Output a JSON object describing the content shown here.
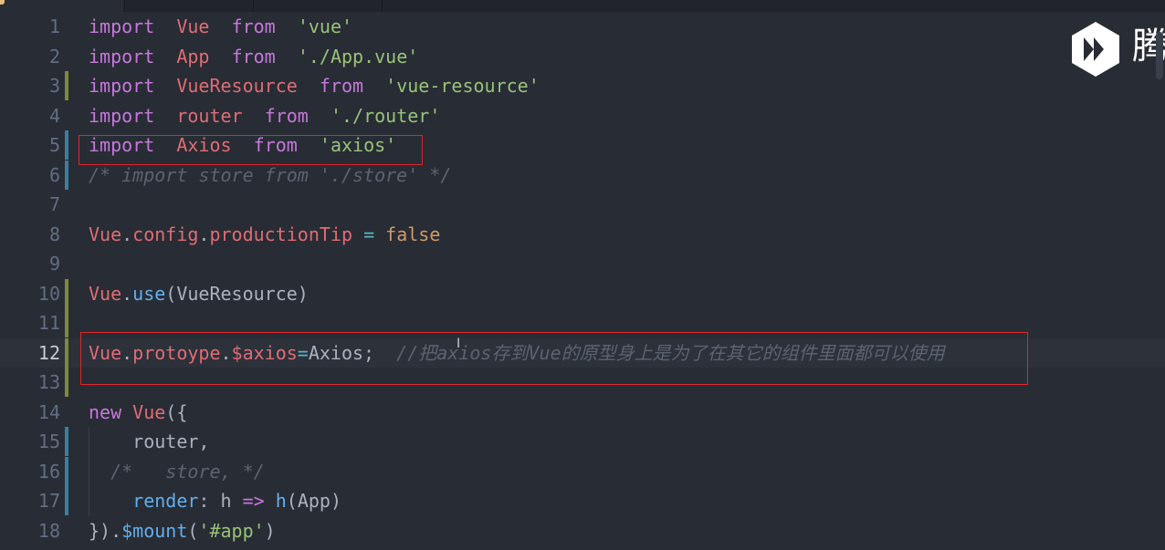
{
  "lines": [
    {
      "n": "1",
      "tokens": [
        [
          "kw",
          "import"
        ],
        [
          "",
          "  "
        ],
        [
          "id",
          "Vue"
        ],
        [
          "",
          "  "
        ],
        [
          "kw",
          "from"
        ],
        [
          "",
          "  "
        ],
        [
          "str",
          "'vue'"
        ]
      ]
    },
    {
      "n": "2",
      "tokens": [
        [
          "kw",
          "import"
        ],
        [
          "",
          "  "
        ],
        [
          "id",
          "App"
        ],
        [
          "",
          "  "
        ],
        [
          "kw",
          "from"
        ],
        [
          "",
          "  "
        ],
        [
          "str",
          "'./App.vue'"
        ]
      ]
    },
    {
      "n": "3",
      "tokens": [
        [
          "kw",
          "import"
        ],
        [
          "",
          "  "
        ],
        [
          "id",
          "VueResource"
        ],
        [
          "",
          "  "
        ],
        [
          "kw",
          "from"
        ],
        [
          "",
          "  "
        ],
        [
          "str",
          "'vue-resource'"
        ]
      ]
    },
    {
      "n": "4",
      "tokens": [
        [
          "kw",
          "import"
        ],
        [
          "",
          "  "
        ],
        [
          "id",
          "router"
        ],
        [
          "",
          "  "
        ],
        [
          "kw",
          "from"
        ],
        [
          "",
          "  "
        ],
        [
          "str",
          "'./router'"
        ]
      ]
    },
    {
      "n": "5",
      "tokens": [
        [
          "kw",
          "import"
        ],
        [
          "",
          "  "
        ],
        [
          "id",
          "Axios"
        ],
        [
          "",
          "  "
        ],
        [
          "kw",
          "from"
        ],
        [
          "",
          "  "
        ],
        [
          "str",
          "'axios'"
        ]
      ]
    },
    {
      "n": "6",
      "tokens": [
        [
          "cm",
          "/* import store from './store' */"
        ]
      ]
    },
    {
      "n": "7",
      "tokens": []
    },
    {
      "n": "8",
      "tokens": [
        [
          "id",
          "Vue"
        ],
        [
          "",
          "."
        ],
        [
          "id",
          "config"
        ],
        [
          "",
          "."
        ],
        [
          "id",
          "productionTip"
        ],
        [
          "",
          " "
        ],
        [
          "op",
          "="
        ],
        [
          "",
          " "
        ],
        [
          "lit",
          "false"
        ]
      ]
    },
    {
      "n": "9",
      "tokens": []
    },
    {
      "n": "10",
      "tokens": [
        [
          "id",
          "Vue"
        ],
        [
          "",
          "."
        ],
        [
          "fn",
          "use"
        ],
        [
          "",
          "(VueResource)"
        ]
      ]
    },
    {
      "n": "11",
      "tokens": []
    },
    {
      "n": "12",
      "tokens": [
        [
          "id",
          "Vue"
        ],
        [
          "",
          "."
        ],
        [
          "id",
          "protoype"
        ],
        [
          "",
          "."
        ],
        [
          "id",
          "$axios"
        ],
        [
          "op",
          "="
        ],
        [
          "",
          "Axios;  "
        ],
        [
          "cm",
          "//把axios存到Vue的原型身上是为了在其它的组件里面都可以使用"
        ]
      ]
    },
    {
      "n": "13",
      "tokens": []
    },
    {
      "n": "14",
      "tokens": [
        [
          "kw",
          "new"
        ],
        [
          "",
          " "
        ],
        [
          "id",
          "Vue"
        ],
        [
          "",
          "({"
        ]
      ]
    },
    {
      "n": "15",
      "tokens": [
        [
          "",
          "    router,"
        ]
      ]
    },
    {
      "n": "16",
      "tokens": [
        [
          "",
          "  "
        ],
        [
          "cm",
          "/*   store, */"
        ]
      ]
    },
    {
      "n": "17",
      "tokens": [
        [
          "",
          "    "
        ],
        [
          "fn",
          "render"
        ],
        [
          "",
          ": h "
        ],
        [
          "kw",
          "=>"
        ],
        [
          "",
          " "
        ],
        [
          "fn",
          "h"
        ],
        [
          "",
          "(App)"
        ]
      ]
    },
    {
      "n": "18",
      "tokens": [
        [
          "",
          "})."
        ],
        [
          "fn",
          "$mount"
        ],
        [
          "",
          "("
        ],
        [
          "str",
          "'#app'"
        ],
        [
          "",
          ")"
        ]
      ]
    }
  ],
  "current_line": "12",
  "logo": {
    "text": "腾"
  }
}
